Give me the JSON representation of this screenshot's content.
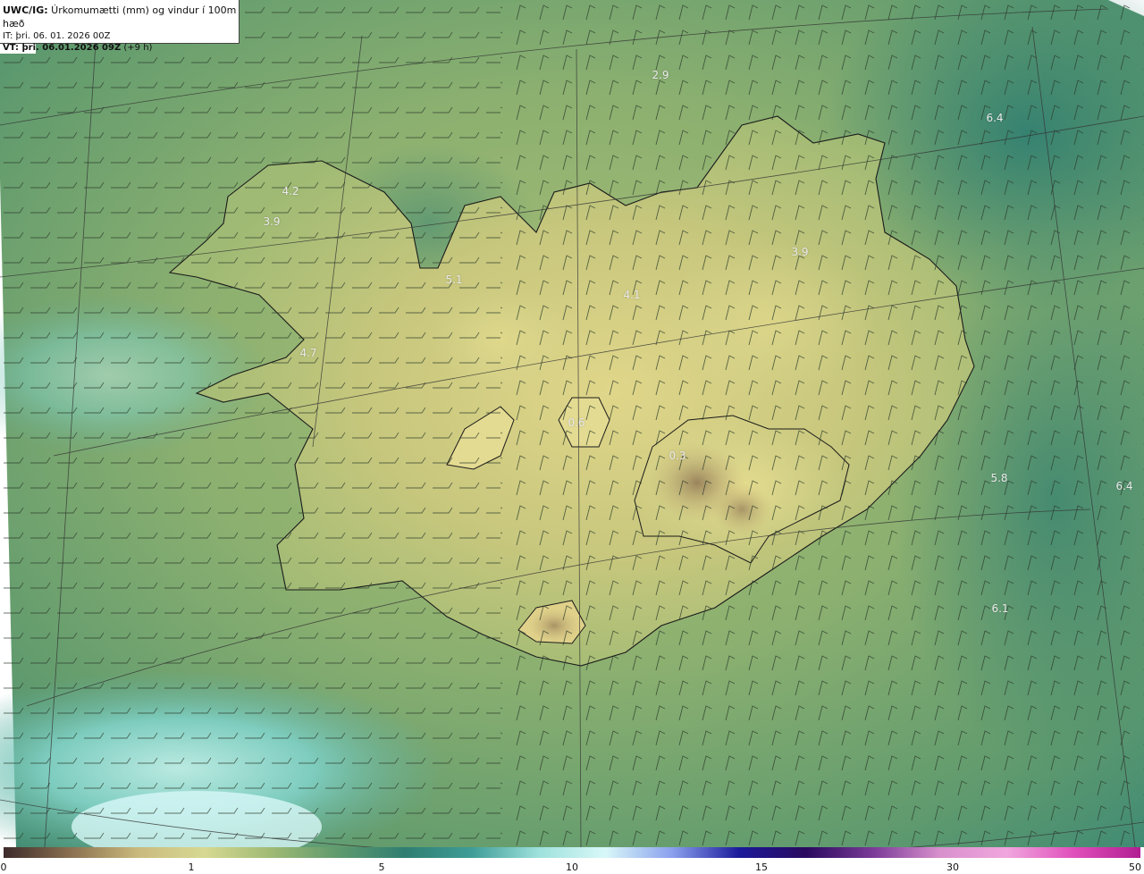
{
  "header": {
    "model": "UWC/IG:",
    "product": " Úrkomumætti (mm) og vindur í 100m hæð",
    "issue_time": "IT: þri. 06. 01. 2026 00Z",
    "valid_prefix": "VT:",
    "valid_time": " þri. 06.01.2026 09Z",
    "lead_time": " (+9 h)"
  },
  "map": {
    "point_values": [
      {
        "value": "2.9"
      },
      {
        "value": "6.4"
      },
      {
        "value": "4.2"
      },
      {
        "value": "3.9"
      },
      {
        "value": "5.1"
      },
      {
        "value": "4.1"
      },
      {
        "value": "3.9"
      },
      {
        "value": "4.7"
      },
      {
        "value": "0.6"
      },
      {
        "value": "0.3"
      },
      {
        "value": "5.8"
      },
      {
        "value": "6.4"
      },
      {
        "value": "6.1"
      }
    ]
  },
  "colorbar": {
    "ticks": [
      "0",
      "1",
      "5",
      "10",
      "15",
      "30",
      "50"
    ],
    "colors": [
      "#3d2b2b",
      "#8a7050",
      "#c9b97d",
      "#d7d992",
      "#9fba74",
      "#5f9a6e",
      "#2f7e71",
      "#3f9d97",
      "#9ee1dc",
      "#d8f8f8",
      "#8aa0ee",
      "#1b1a9a",
      "#2a0a5e",
      "#7a3a98",
      "#d890cc",
      "#f0a6de",
      "#e04fbb",
      "#b21e92"
    ]
  }
}
